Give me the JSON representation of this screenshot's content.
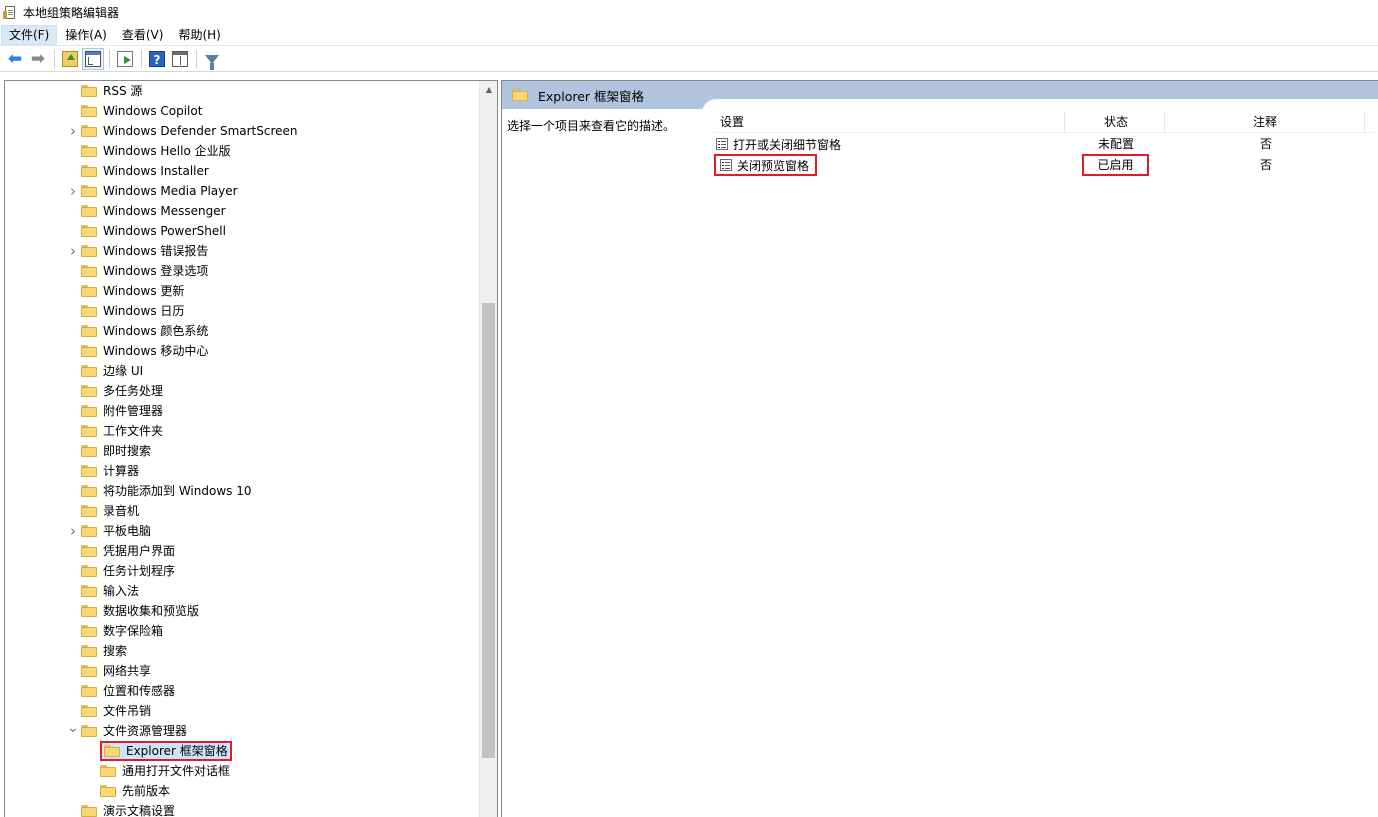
{
  "window": {
    "title": "本地组策略编辑器",
    "icon": "gpedit-icon"
  },
  "menu": [
    {
      "label": "文件(F)",
      "active": true
    },
    {
      "label": "操作(A)"
    },
    {
      "label": "查看(V)"
    },
    {
      "label": "帮助(H)"
    }
  ],
  "toolbar": [
    "back-arrow-icon",
    "forward-arrow-icon",
    "up-folder-icon",
    "show-hide-tree-icon",
    "export-list-icon",
    "help-icon",
    "view-pane-icon",
    "filter-icon"
  ],
  "tree": {
    "items": [
      {
        "label": "RSS 源",
        "expandable": false
      },
      {
        "label": "Windows Copilot",
        "expandable": false
      },
      {
        "label": "Windows Defender SmartScreen",
        "expandable": true
      },
      {
        "label": "Windows Hello 企业版",
        "expandable": false
      },
      {
        "label": "Windows Installer",
        "expandable": false
      },
      {
        "label": "Windows Media Player",
        "expandable": true
      },
      {
        "label": "Windows Messenger",
        "expandable": false
      },
      {
        "label": "Windows PowerShell",
        "expandable": false
      },
      {
        "label": "Windows 错误报告",
        "expandable": true
      },
      {
        "label": "Windows 登录选项",
        "expandable": false
      },
      {
        "label": "Windows 更新",
        "expandable": false
      },
      {
        "label": "Windows 日历",
        "expandable": false
      },
      {
        "label": "Windows 颜色系统",
        "expandable": false
      },
      {
        "label": "Windows 移动中心",
        "expandable": false
      },
      {
        "label": "边缘 UI",
        "expandable": false
      },
      {
        "label": "多任务处理",
        "expandable": false
      },
      {
        "label": "附件管理器",
        "expandable": false
      },
      {
        "label": "工作文件夹",
        "expandable": false
      },
      {
        "label": "即时搜索",
        "expandable": false
      },
      {
        "label": "计算器",
        "expandable": false
      },
      {
        "label": "将功能添加到 Windows 10",
        "expandable": false
      },
      {
        "label": "录音机",
        "expandable": false
      },
      {
        "label": "平板电脑",
        "expandable": true
      },
      {
        "label": "凭据用户界面",
        "expandable": false
      },
      {
        "label": "任务计划程序",
        "expandable": false
      },
      {
        "label": "输入法",
        "expandable": false
      },
      {
        "label": "数据收集和预览版",
        "expandable": false
      },
      {
        "label": "数字保险箱",
        "expandable": false
      },
      {
        "label": "搜索",
        "expandable": false
      },
      {
        "label": "网络共享",
        "expandable": false
      },
      {
        "label": "位置和传感器",
        "expandable": false
      },
      {
        "label": "文件吊销",
        "expandable": false
      },
      {
        "label": "文件资源管理器",
        "expandable": true,
        "expanded": true
      },
      {
        "label": "Explorer 框架窗格",
        "child": true,
        "selected": true
      },
      {
        "label": "通用打开文件对话框",
        "child": true
      },
      {
        "label": "先前版本",
        "child": true
      },
      {
        "label": "演示文稿设置",
        "expandable": false
      }
    ]
  },
  "details": {
    "header": "Explorer 框架窗格",
    "description": "选择一个项目来查看它的描述。",
    "columns": {
      "setting": "设置",
      "state": "状态",
      "comment": "注释"
    },
    "rows": [
      {
        "setting": "打开或关闭细节窗格",
        "state": "未配置",
        "comment": "否"
      },
      {
        "setting": "关闭预览窗格",
        "state": "已启用",
        "comment": "否",
        "highlighted": true
      }
    ]
  },
  "colors": {
    "header_band": "#b0c4de",
    "highlight_box": "#e01c27",
    "selection": "#cde5fb",
    "folder": "#f8d775"
  }
}
